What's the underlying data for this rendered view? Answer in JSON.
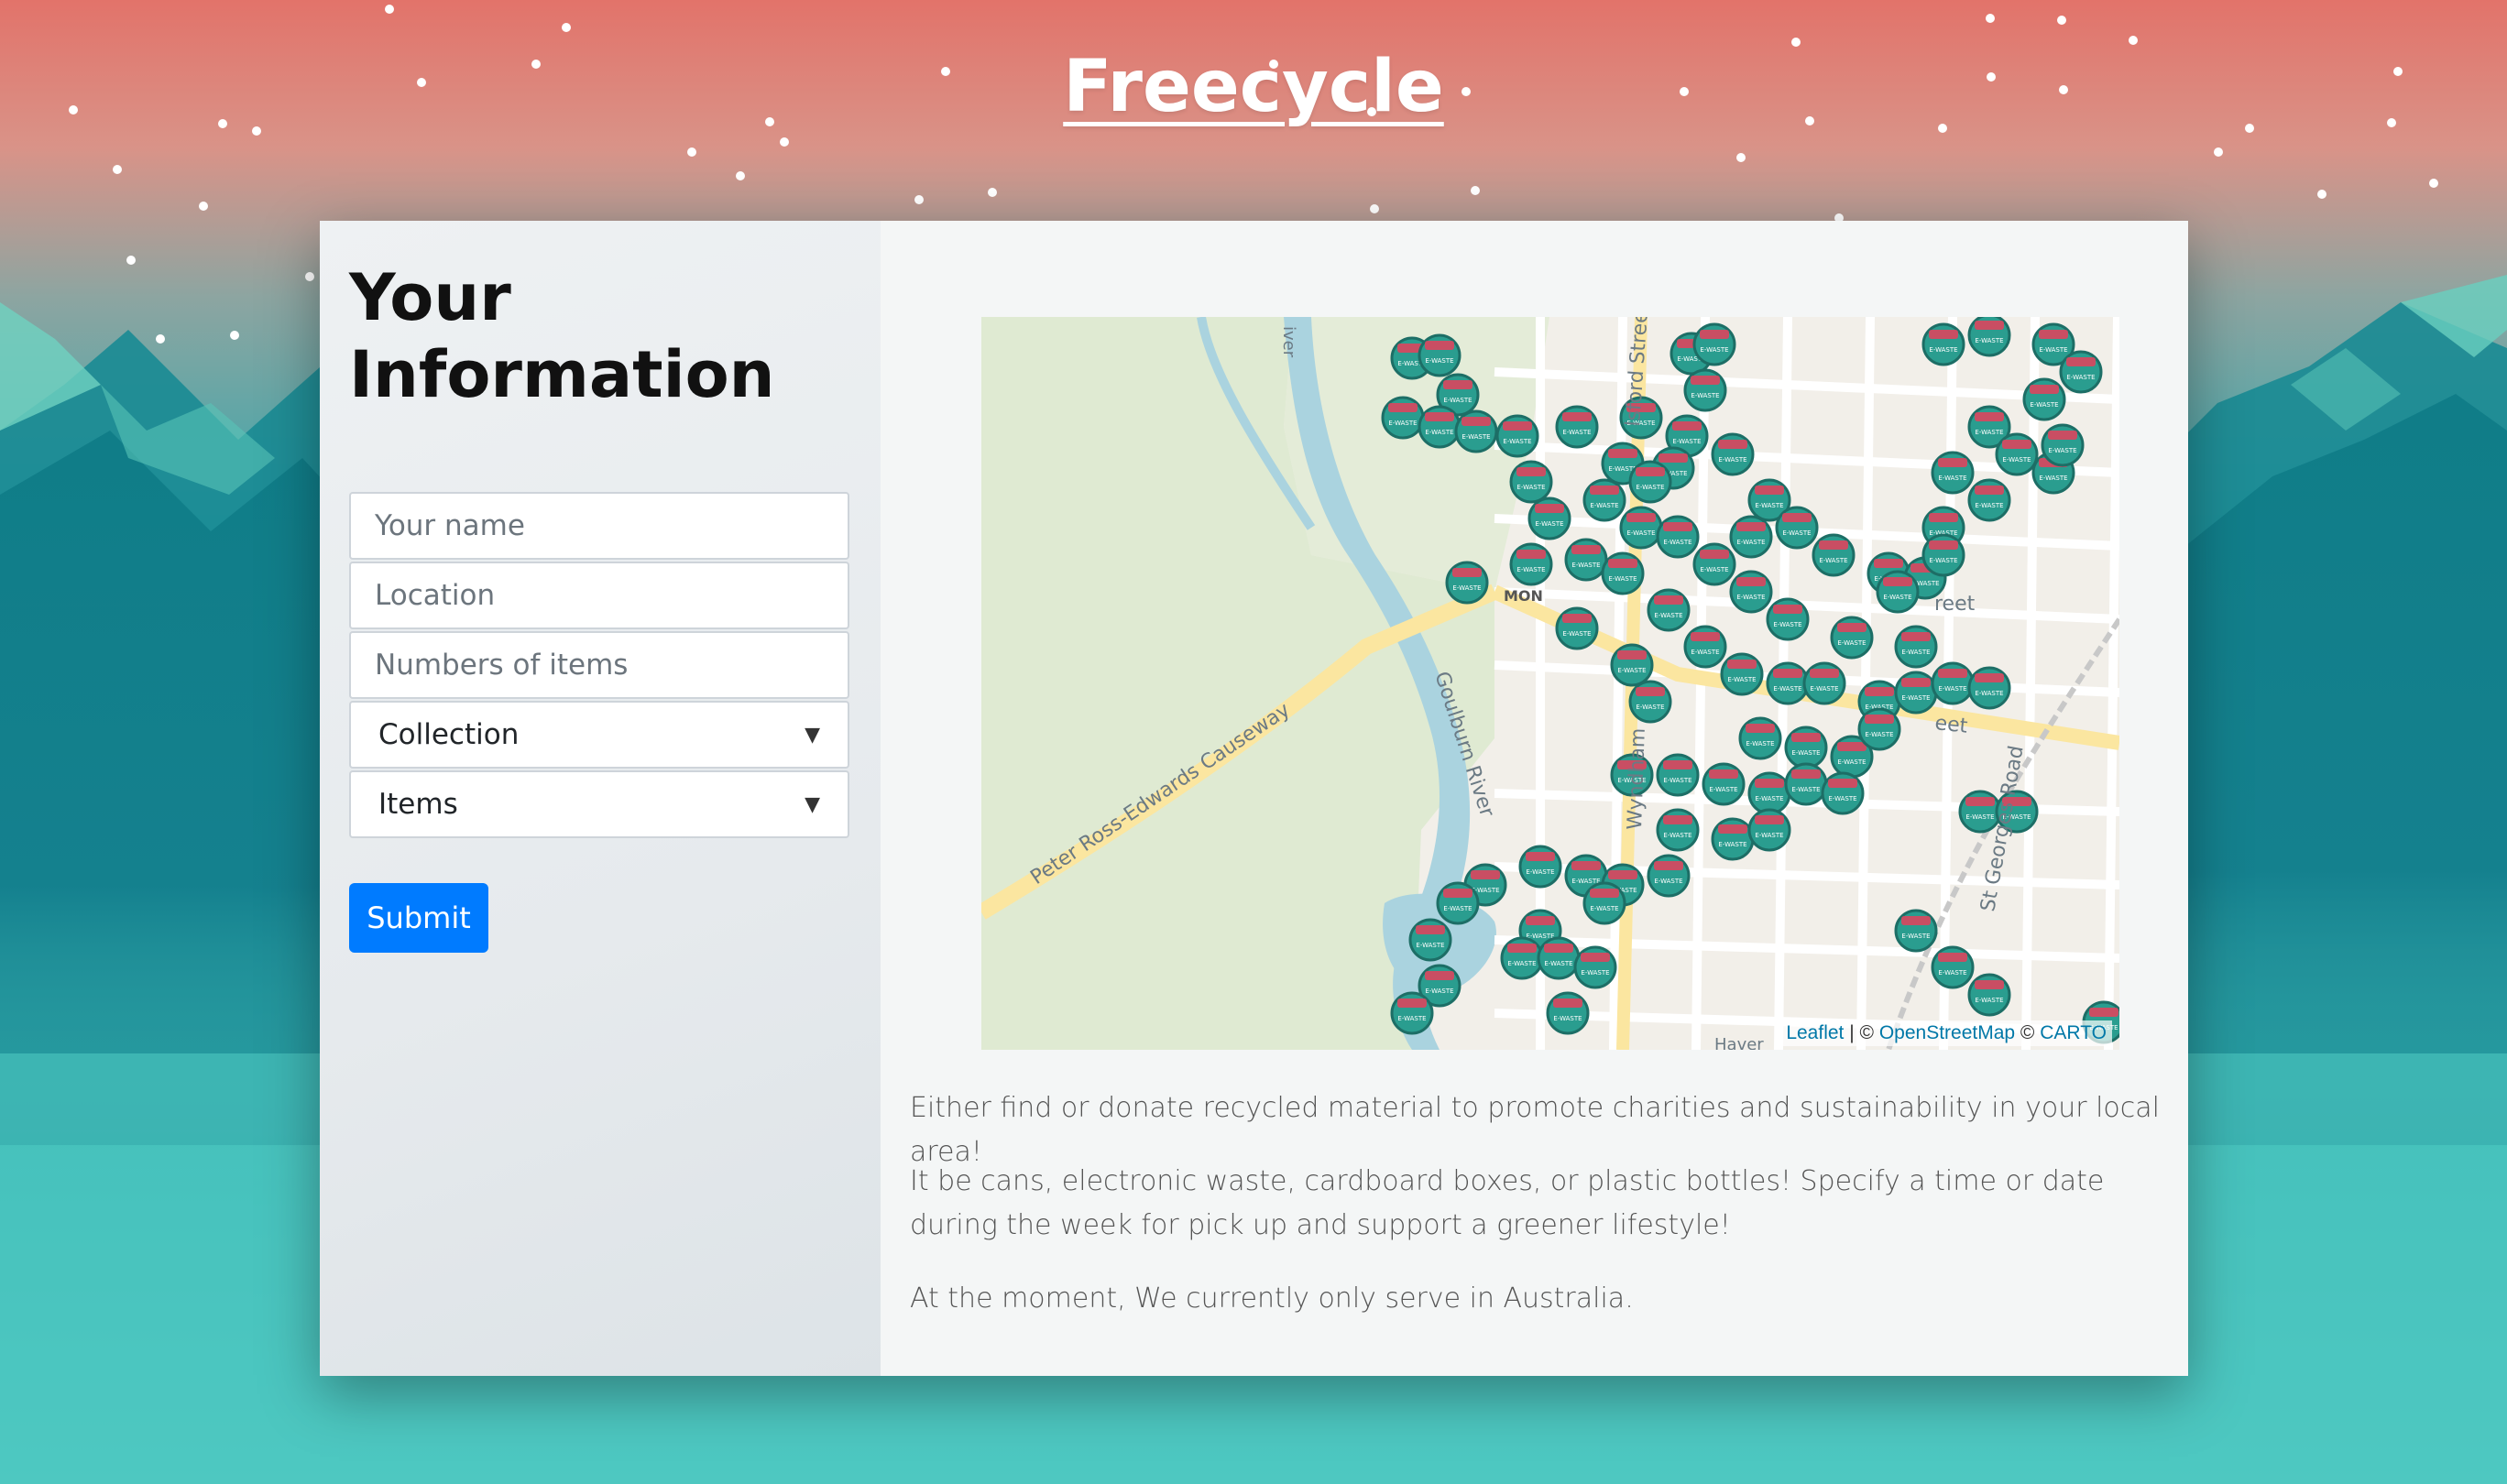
{
  "header": {
    "title": "Freecycle"
  },
  "form": {
    "heading": "Your Information",
    "name_placeholder": "Your name",
    "location_placeholder": "Location",
    "items_count_placeholder": "Numbers of items",
    "collection_select": "Collection",
    "items_select": "Items",
    "submit_label": "Submit"
  },
  "map": {
    "labels": {
      "causeway": "Peter Ross-Edwards Causeway",
      "river": "Goulburn River",
      "river_short": "iver",
      "st_georges": "St Georges Road",
      "wyndham": "Wyndham",
      "welsford": "lsford Street",
      "street_a": "reet",
      "street_b": "eet",
      "mon": "MON",
      "haver": "Haver"
    },
    "marker_label": "E-WASTE",
    "attribution": {
      "leaflet": "Leaflet",
      "sep": " | © ",
      "osm": "OpenStreetMap",
      "carto_sep": " © ",
      "carto": "CARTO"
    }
  },
  "description": {
    "p1": "Either find or donate recycled material to promote charities and sustainability in your local area!",
    "p2": "It be cans, electronic waste, cardboard boxes, or plastic bottles! Specify a time or date during the week for pick up and support a greener lifestyle!",
    "p3": "At the moment, We currently only serve in Australia."
  },
  "colors": {
    "primary": "#007bff",
    "marker": "#2a9d8f",
    "marker_dark": "#1d6e66"
  }
}
